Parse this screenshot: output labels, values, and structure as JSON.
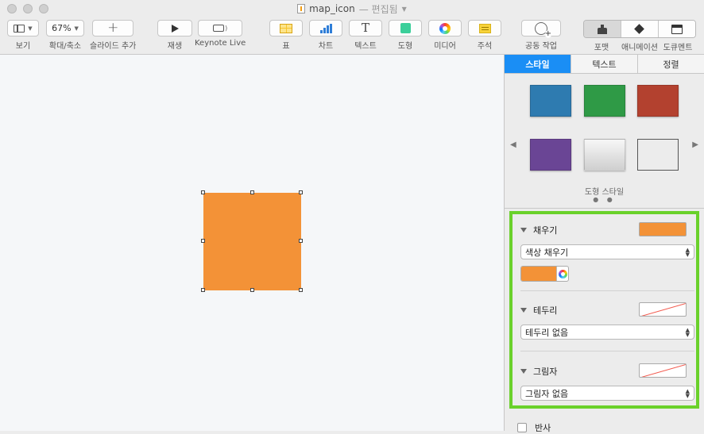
{
  "window": {
    "filename": "map_icon",
    "status": "— 편집됨"
  },
  "toolbar": {
    "view_label": "보기",
    "zoom_value": "67%",
    "zoom_label": "확대/축소",
    "add_slide_label": "슬라이드 추가",
    "play_label": "재생",
    "keynote_live_label": "Keynote Live",
    "table_label": "표",
    "chart_label": "차트",
    "text_label": "텍스트",
    "shape_label": "도형",
    "media_label": "미디어",
    "comment_label": "주석",
    "collaborate_label": "공동 작업",
    "format_label": "포맷",
    "animate_label": "애니메이션",
    "document_label": "도큐멘트"
  },
  "canvas": {
    "shape_color": "#f39237"
  },
  "inspector": {
    "tabs": [
      "스타일",
      "텍스트",
      "정렬"
    ],
    "active_tab": "스타일",
    "style_swatches": [
      "#2e7bb0",
      "#2f9a46",
      "#b3412f",
      "#6a4595",
      "#e6e6e6",
      "#ffffff"
    ],
    "styles_caption": "도형 스타일",
    "page_dots": "● ●",
    "fill": {
      "title": "채우기",
      "color": "#f39237",
      "type": "색상 채우기"
    },
    "border": {
      "title": "테두리",
      "type": "테두리 없음"
    },
    "shadow": {
      "title": "그림자",
      "type": "그림자 없음"
    },
    "reflection_label": "반사"
  }
}
